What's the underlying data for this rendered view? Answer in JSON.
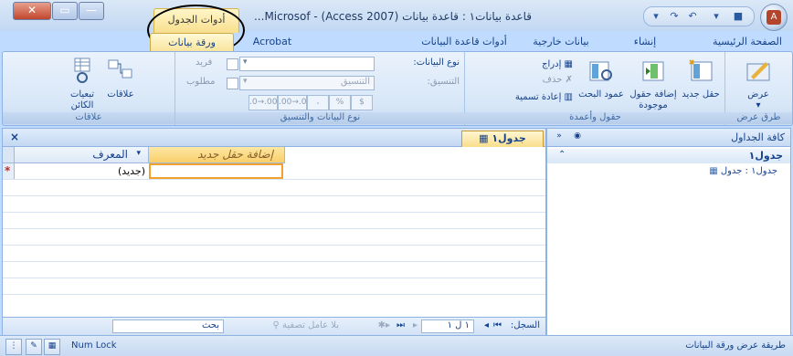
{
  "window": {
    "title": "قاعدة بيانات١ : قاعدة بيانات (Access 2007) - Microsof...",
    "context_tab": "أدوات الجدول",
    "office_button_letter": "A"
  },
  "quick_access": [
    "save-icon",
    "undo-icon",
    "redo-icon",
    "customize-icon"
  ],
  "ribbon_tabs": [
    {
      "label": "الصفحة الرئيسية"
    },
    {
      "label": "إنشاء"
    },
    {
      "label": "بيانات خارجية"
    },
    {
      "label": "أدوات قاعدة البيانات"
    },
    {
      "label": "Acrobat"
    },
    {
      "label": "ورقة بيانات"
    }
  ],
  "groups": {
    "views": {
      "label": "طرق عرض",
      "view_button": "عرض"
    },
    "fields_columns": {
      "label": "حقول وأعمدة",
      "new_field": "حقل جديد",
      "add_existing": "إضافة حقول موجودة",
      "lookup_column": "عمود البحث",
      "insert": "إدراج",
      "delete": "حذف",
      "rename": "إعادة تسمية"
    },
    "data_type_formatting": {
      "label": "نوع البيانات والتنسيق",
      "data_type_label": "نوع البيانات:",
      "format_label": "التنسيق:",
      "format_value": "التنسيق",
      "unique": "فريد",
      "required": "مطلوب",
      "format_buttons": [
        "$",
        "%",
        "،",
        "‎.00→.0",
        "‎.0→.00"
      ]
    },
    "relationships": {
      "label": "علاقات",
      "relationships_btn": "علاقات",
      "dependencies_btn": "تبعيات الكائن"
    }
  },
  "nav_pane": {
    "title": "كافة الجداول",
    "group": "جدول١",
    "item": "جدول١ : جدول"
  },
  "document": {
    "tab": "جدول١",
    "columns": [
      {
        "label": "المعرف"
      },
      {
        "label": "إضافة حقل جديد"
      }
    ],
    "new_row_marker": "*",
    "new_row_value": "(جديد)",
    "record_label": "السجل:",
    "record_position": "١ ل ١",
    "filter_label": "بلا عامل تصفية",
    "search_placeholder": "بحث"
  },
  "status": {
    "left_text": "طريقة عرض ورقة البيانات",
    "num_lock": "Num Lock"
  },
  "colors": {
    "accent": "#15428b",
    "ribbon_bg": "#d8e7f8",
    "context_tab": "#f8df8e",
    "active_cell": "#f2a22c"
  }
}
